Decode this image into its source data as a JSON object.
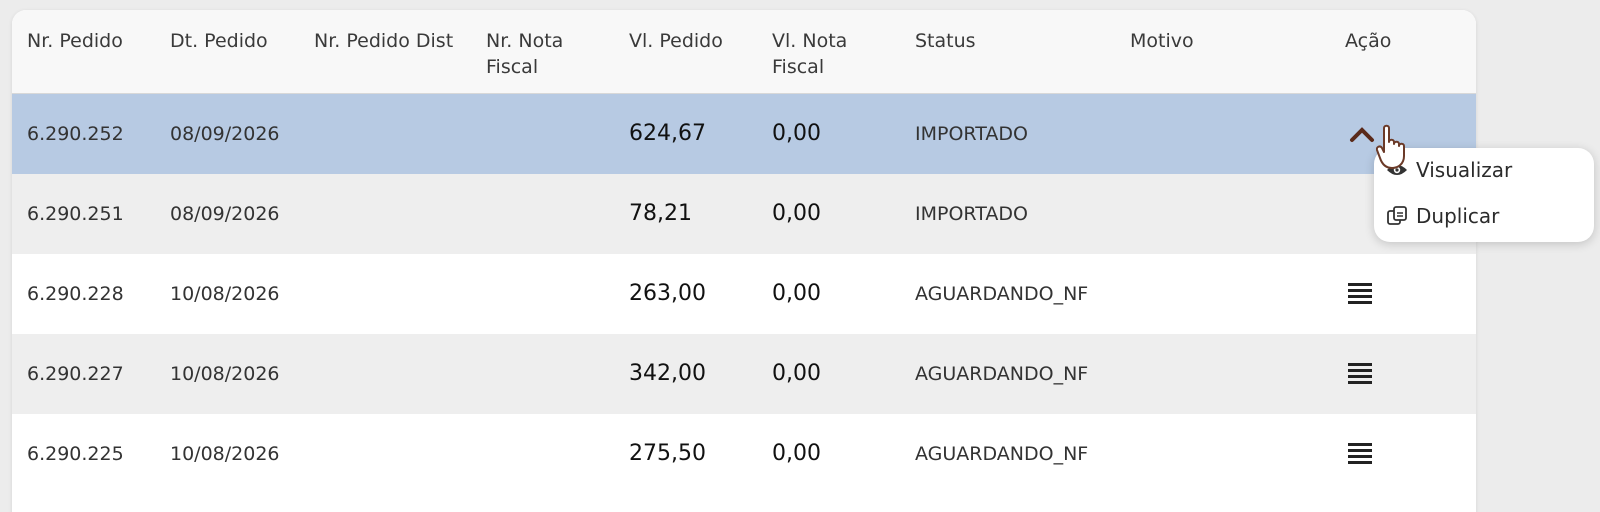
{
  "table": {
    "headers": {
      "nr_pedido": "Nr. Pedido",
      "dt_pedido": "Dt. Pedido",
      "nr_pedido_dist": "Nr. Pedido Dist",
      "nr_nota_fiscal": "Nr. Nota Fiscal",
      "vl_pedido": "Vl. Pedido",
      "vl_nota_fiscal": "Vl. Nota Fiscal",
      "status": "Status",
      "motivo": "Motivo",
      "acao": "Ação"
    },
    "rows": [
      {
        "nr_pedido": "6.290.252",
        "dt_pedido": "08/09/2026",
        "nr_pedido_dist": "",
        "nr_nota_fiscal": "",
        "vl_pedido": "624,67",
        "vl_nota_fiscal": "0,00",
        "status": "IMPORTADO",
        "motivo": "",
        "selected": true
      },
      {
        "nr_pedido": "6.290.251",
        "dt_pedido": "08/09/2026",
        "nr_pedido_dist": "",
        "nr_nota_fiscal": "",
        "vl_pedido": "78,21",
        "vl_nota_fiscal": "0,00",
        "status": "IMPORTADO",
        "motivo": ""
      },
      {
        "nr_pedido": "6.290.228",
        "dt_pedido": "10/08/2026",
        "nr_pedido_dist": "",
        "nr_nota_fiscal": "",
        "vl_pedido": "263,00",
        "vl_nota_fiscal": "0,00",
        "status": "AGUARDANDO_NF",
        "motivo": ""
      },
      {
        "nr_pedido": "6.290.227",
        "dt_pedido": "10/08/2026",
        "nr_pedido_dist": "",
        "nr_nota_fiscal": "",
        "vl_pedido": "342,00",
        "vl_nota_fiscal": "0,00",
        "status": "AGUARDANDO_NF",
        "motivo": ""
      },
      {
        "nr_pedido": "6.290.225",
        "dt_pedido": "10/08/2026",
        "nr_pedido_dist": "",
        "nr_nota_fiscal": "",
        "vl_pedido": "275,50",
        "vl_nota_fiscal": "0,00",
        "status": "AGUARDANDO_NF",
        "motivo": ""
      }
    ]
  },
  "action_menu": {
    "items": [
      {
        "label": "Visualizar",
        "icon": "eye-icon"
      },
      {
        "label": "Duplicar",
        "icon": "copy-icon"
      }
    ]
  },
  "colors": {
    "selected_row": "#b7cae3",
    "alt_row": "#eeeeee",
    "header_bg": "#f8f8f8"
  }
}
